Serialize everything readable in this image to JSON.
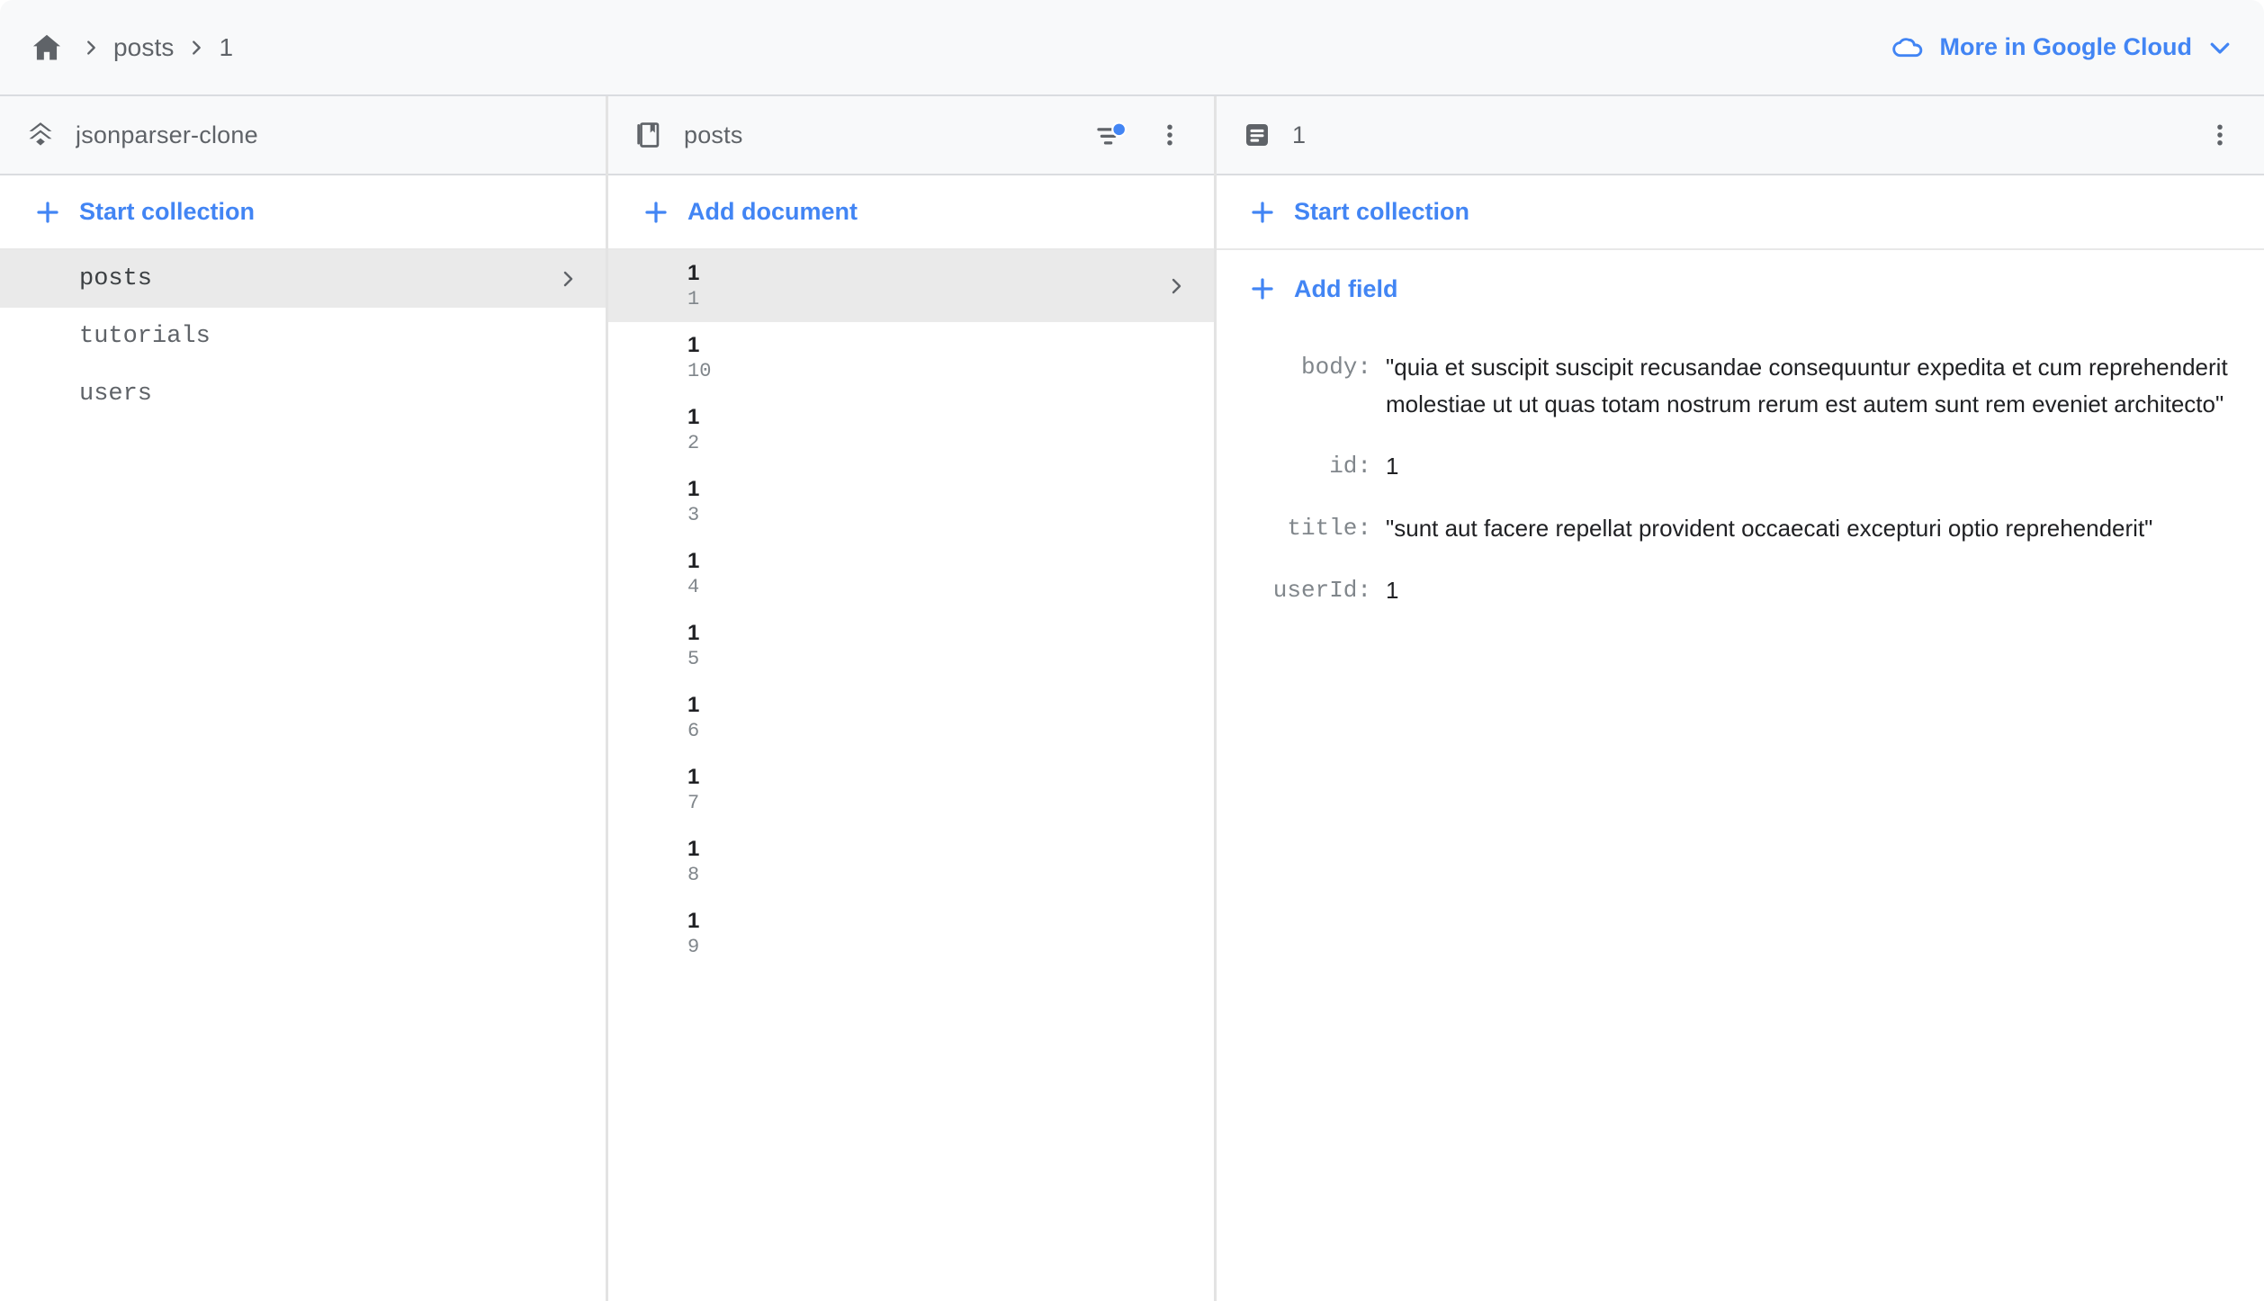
{
  "topbar": {
    "home_icon": "home-icon",
    "breadcrumb": [
      {
        "label": "posts"
      },
      {
        "label": "1"
      }
    ],
    "cloud_link": {
      "icon": "google-cloud-icon",
      "label": "More in Google Cloud",
      "chevron": "chevron-down-icon"
    },
    "accent_color": "#4285f4",
    "background": "#f8f9fa"
  },
  "panel_project": {
    "icon": "firestore-database-icon",
    "title": "jsonparser-clone",
    "start_collection_label": "Start collection",
    "collections": [
      {
        "name": "posts",
        "selected": true
      },
      {
        "name": "tutorials",
        "selected": false
      },
      {
        "name": "users",
        "selected": false
      }
    ]
  },
  "panel_collection": {
    "icon": "collection-icon",
    "title": "posts",
    "filter_icon": "filter-sort-icon",
    "filter_active": true,
    "overflow_icon": "more-vert-icon",
    "add_document_label": "Add document",
    "documents": [
      {
        "preview": "1",
        "id": "1",
        "selected": true
      },
      {
        "preview": "1",
        "id": "10",
        "selected": false
      },
      {
        "preview": "1",
        "id": "2",
        "selected": false
      },
      {
        "preview": "1",
        "id": "3",
        "selected": false
      },
      {
        "preview": "1",
        "id": "4",
        "selected": false
      },
      {
        "preview": "1",
        "id": "5",
        "selected": false
      },
      {
        "preview": "1",
        "id": "6",
        "selected": false
      },
      {
        "preview": "1",
        "id": "7",
        "selected": false
      },
      {
        "preview": "1",
        "id": "8",
        "selected": false
      },
      {
        "preview": "1",
        "id": "9",
        "selected": false
      }
    ]
  },
  "panel_document": {
    "icon": "document-icon",
    "title": "1",
    "overflow_icon": "more-vert-icon",
    "start_collection_label": "Start collection",
    "add_field_label": "Add field",
    "fields": [
      {
        "key": "body:",
        "value": "\"quia et suscipit suscipit recusandae consequuntur expedita et cum reprehenderit molestiae ut ut quas totam nostrum rerum est autem sunt rem eveniet architecto\""
      },
      {
        "key": "id:",
        "value": "1"
      },
      {
        "key": "title:",
        "value": "\"sunt aut facere repellat provident occaecati excepturi optio reprehenderit\""
      },
      {
        "key": "userId:",
        "value": "1"
      }
    ]
  }
}
